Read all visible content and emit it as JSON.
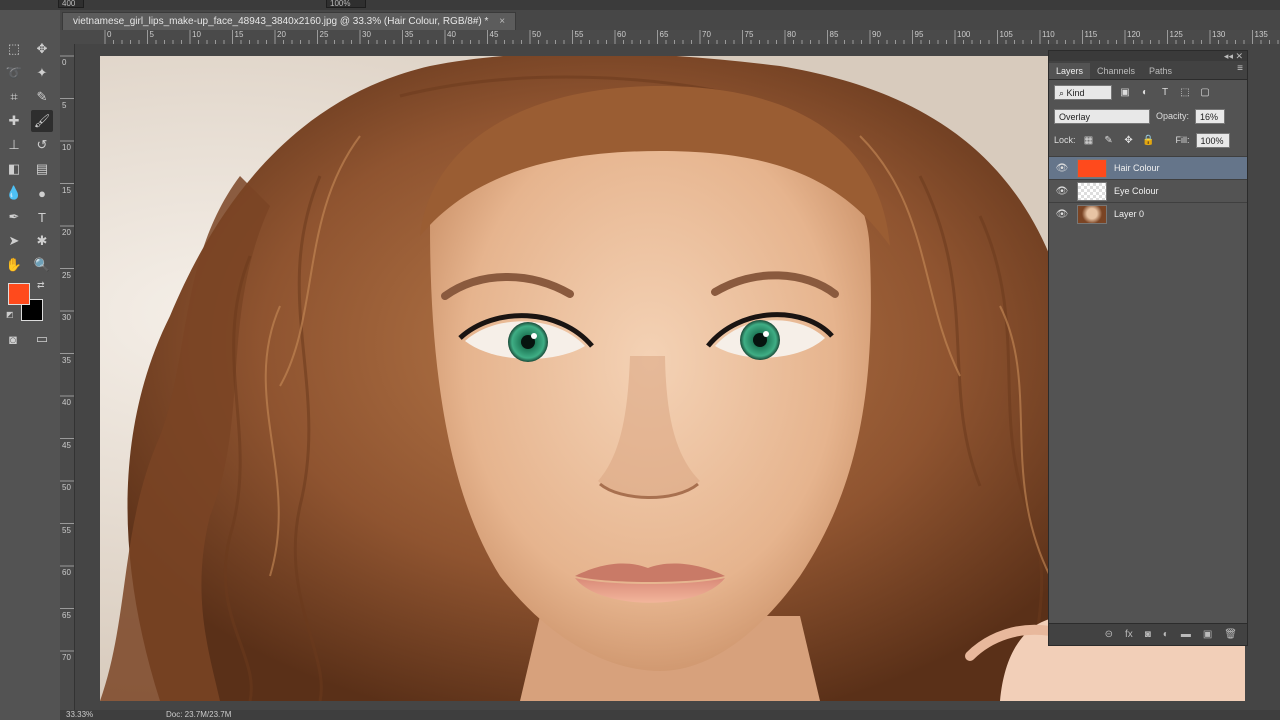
{
  "options_bar": {
    "brush_size": "400",
    "zoom_field": "100%"
  },
  "document": {
    "tab_title": "vietnamese_girl_lips_make-up_face_48943_3840x2160.jpg @ 33.3% (Hair Colour, RGB/8#) *",
    "close": "×"
  },
  "ruler": {
    "h_labels": [
      "0",
      "5",
      "10",
      "15",
      "20",
      "25",
      "30",
      "35",
      "40",
      "45",
      "50",
      "55",
      "60",
      "65",
      "70",
      "75",
      "80",
      "85",
      "90",
      "95",
      "100",
      "105",
      "110",
      "115",
      "120",
      "125",
      "130",
      "135"
    ],
    "v_labels": [
      "0",
      "5",
      "10",
      "15",
      "20",
      "25",
      "30",
      "35",
      "40",
      "45",
      "50",
      "55",
      "60",
      "65",
      "70"
    ]
  },
  "colors": {
    "foreground": "#ff4a1c",
    "background": "#000000",
    "selected_layer": "#65758a"
  },
  "status": {
    "zoom": "33.33%",
    "doc": "Doc: 23.7M/23.7M"
  },
  "layers_panel": {
    "collapse": "◂◂  ✕",
    "tabs": [
      "Layers",
      "Channels",
      "Paths"
    ],
    "menu_icon": "≡",
    "filter_kind": "Kind",
    "blend_mode": "Overlay",
    "opacity_label": "Opacity:",
    "opacity_value": "16%",
    "lock_label": "Lock:",
    "fill_label": "Fill:",
    "fill_value": "100%",
    "layers": [
      {
        "name": "Hair Colour",
        "selected": true,
        "thumb": "orange-fill"
      },
      {
        "name": "Eye Colour",
        "selected": false,
        "thumb": "transparent"
      },
      {
        "name": "Layer 0",
        "selected": false,
        "thumb": "photo"
      }
    ]
  }
}
